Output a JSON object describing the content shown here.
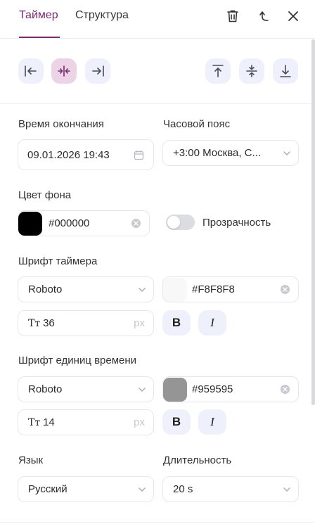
{
  "header": {
    "tabs": [
      {
        "label": "Таймер",
        "active": true
      },
      {
        "label": "Структура",
        "active": false
      }
    ],
    "icons": [
      "trash-icon",
      "undo-icon",
      "close-icon"
    ]
  },
  "alignment": {
    "horizontal": [
      "align-left-icon",
      "align-center-h-icon",
      "align-right-icon"
    ],
    "vertical": [
      "align-top-icon",
      "align-center-v-icon",
      "align-bottom-icon"
    ],
    "active": "align-center-h-icon"
  },
  "end_time": {
    "label": "Время окончания",
    "value": "09.01.2026 19:43"
  },
  "timezone": {
    "label": "Часовой пояс",
    "value": "+3:00 Москва, С..."
  },
  "background": {
    "label": "Цвет фона",
    "color": "#000000",
    "value": "#000000"
  },
  "transparency": {
    "label": "Прозрачность",
    "on": false
  },
  "timer_font": {
    "label": "Шрифт таймера",
    "family": "Roboto",
    "color": "#F8F8F8",
    "color_value": "#F8F8F8",
    "size": "36",
    "unit": "px",
    "bold": "B",
    "italic": "I"
  },
  "units_font": {
    "label": "Шрифт единиц времени",
    "family": "Roboto",
    "color": "#959595",
    "color_value": "#959595",
    "size": "14",
    "unit": "px",
    "bold": "B",
    "italic": "I"
  },
  "language": {
    "label": "Язык",
    "value": "Русский"
  },
  "duration": {
    "label": "Длительность",
    "value": "20 s"
  },
  "colors": {
    "accent": "#7a2a6e",
    "active_btn": "#ecd3e6",
    "btn": "#eef0fb",
    "border": "#e6e6ef"
  }
}
